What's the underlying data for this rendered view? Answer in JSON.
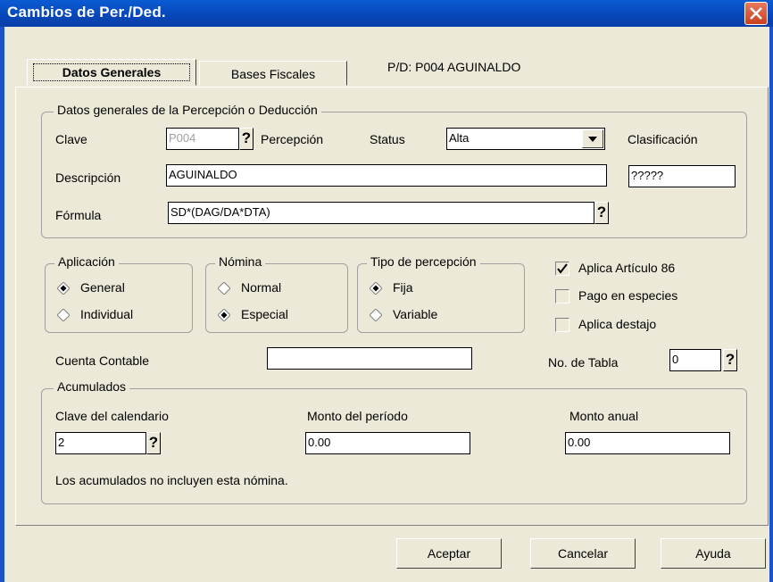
{
  "window": {
    "title": "Cambios de Per./Ded."
  },
  "tabs": [
    {
      "label": "Datos Generales",
      "active": true
    },
    {
      "label": "Bases Fiscales",
      "active": false
    }
  ],
  "pd_label": "P/D: P004  AGUINALDO",
  "datos_generales": {
    "legend": "Datos generales de la Percepción o Deducción",
    "clave_label": "Clave",
    "clave_value": "P004",
    "percepcion_label": "Percepción",
    "status_label": "Status",
    "status_value": "Alta",
    "clasificacion_label": "Clasificación",
    "clasificacion_value": "?????",
    "descripcion_label": "Descripción",
    "descripcion_value": "AGUINALDO",
    "formula_label": "Fórmula",
    "formula_value": "SD*(DAG/DA*DTA)"
  },
  "aplicacion": {
    "legend": "Aplicación",
    "options": [
      "General",
      "Individual"
    ],
    "selected": "General"
  },
  "nomina": {
    "legend": "Nómina",
    "options": [
      "Normal",
      "Especial"
    ],
    "selected": "Especial"
  },
  "tipo_percepcion": {
    "legend": "Tipo de percepción",
    "options": [
      "Fija",
      "Variable"
    ],
    "selected": "Fija"
  },
  "checks": [
    {
      "label": "Aplica Artículo 86",
      "checked": true
    },
    {
      "label": "Pago en especies",
      "checked": false
    },
    {
      "label": "Aplica destajo",
      "checked": false
    }
  ],
  "cuenta_contable_label": "Cuenta Contable",
  "cuenta_contable_value": "",
  "no_tabla_label": "No. de Tabla",
  "no_tabla_value": "0",
  "acumulados": {
    "legend": "Acumulados",
    "clave_calendario_label": "Clave del calendario",
    "clave_calendario_value": "2",
    "monto_periodo_label": "Monto del período",
    "monto_periodo_value": "0.00",
    "monto_anual_label": "Monto anual",
    "monto_anual_value": "0.00",
    "note": "Los acumulados no incluyen esta nómina."
  },
  "buttons": {
    "aceptar": "Aceptar",
    "cancelar": "Cancelar",
    "ayuda": "Ayuda"
  },
  "icons": {
    "help": "?",
    "close": "close-icon",
    "dropdown": "chevron-down-icon",
    "radio_dot": "diamond-radio-icon",
    "check": "checkmark-icon"
  },
  "colors": {
    "titlebar": "#0a5bd3",
    "close_button": "#d8553a",
    "dialog_bg": "#ece9d8"
  }
}
